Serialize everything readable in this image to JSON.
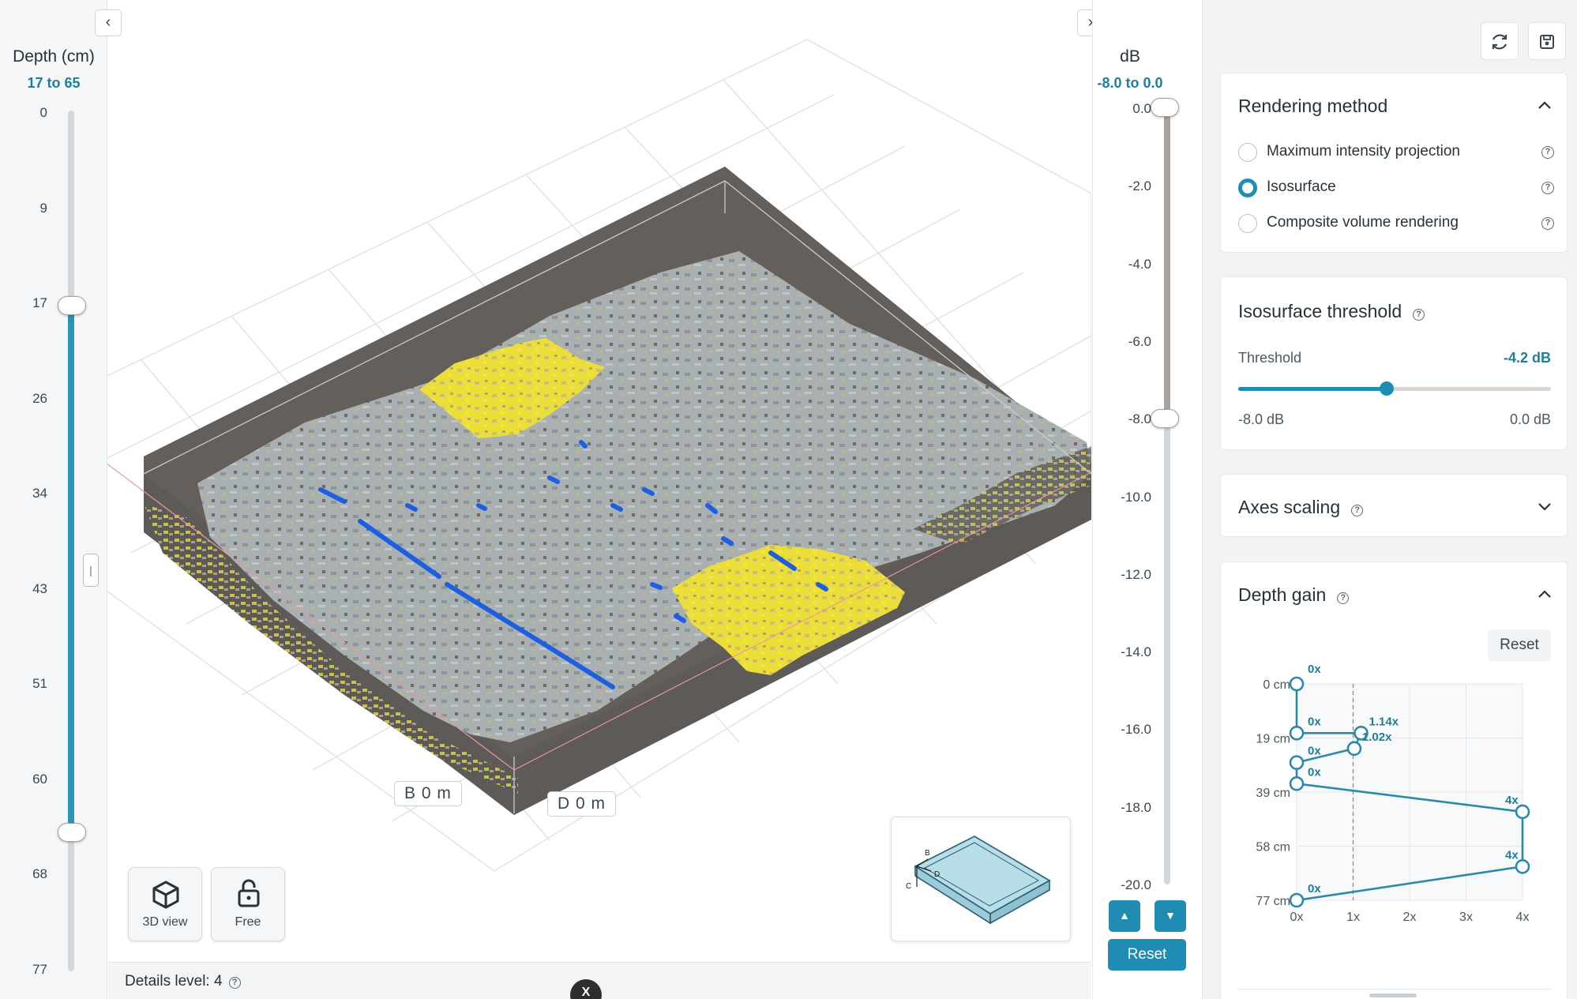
{
  "depth_axis": {
    "title": "Depth (cm)",
    "range": "17 to 65",
    "ticks": [
      "0",
      "9",
      "17",
      "26",
      "34",
      "43",
      "51",
      "60",
      "68",
      "77"
    ],
    "selected_min": 17,
    "selected_max": 65
  },
  "viewport": {
    "collapse_left_icon": "chevron-left-icon",
    "collapse_right_icon": "chevron-right-icon",
    "axis_labels": {
      "b": "B 0 m",
      "d": "D 0 m"
    },
    "tools": [
      {
        "icon": "cube-icon",
        "label": "3D view"
      },
      {
        "icon": "unlock-icon",
        "label": "Free"
      }
    ],
    "details_level": "Details level: 4",
    "orientation_labels": {
      "b": "B",
      "c": "C",
      "d": "D"
    },
    "close_chip": "X"
  },
  "db_axis": {
    "title": "dB",
    "range": "-8.0 to 0.0",
    "ticks": [
      "0.0",
      "-2.0",
      "-4.0",
      "-6.0",
      "-8.0",
      "-10.0",
      "-12.0",
      "-14.0",
      "-16.0",
      "-18.0",
      "-20.0"
    ],
    "selected_max": 0.0,
    "selected_min": -8.0,
    "reset_label": "Reset"
  },
  "panel": {
    "refresh_icon": "refresh-icon",
    "save_icon": "save-icon",
    "rendering": {
      "title": "Rendering method",
      "options": [
        {
          "label": "Maximum intensity projection",
          "selected": false
        },
        {
          "label": "Isosurface",
          "selected": true
        },
        {
          "label": "Composite volume rendering",
          "selected": false
        }
      ]
    },
    "threshold": {
      "title": "Isosurface threshold",
      "label": "Threshold",
      "value": "-4.2 dB",
      "min_label": "-8.0 dB",
      "max_label": "0.0 dB",
      "fraction": 0.475
    },
    "axes_scaling": {
      "title": "Axes scaling"
    },
    "depth_gain": {
      "title": "Depth gain",
      "reset_label": "Reset",
      "chart_data": {
        "type": "line",
        "y_ticks": [
          "0 cm",
          "19 cm",
          "39 cm",
          "58 cm",
          "77 cm"
        ],
        "x_ticks": [
          "0x",
          "1x",
          "2x",
          "3x",
          "4x"
        ],
        "points": [
          {
            "depth": 0,
            "gain": 0,
            "label": "0x"
          },
          {
            "depth": 17.5,
            "gain": 0,
            "label": "0x"
          },
          {
            "depth": 17.5,
            "gain": 1.14,
            "label": "1.14x"
          },
          {
            "depth": 23,
            "gain": 1.02,
            "label": "1.02x"
          },
          {
            "depth": 28,
            "gain": 0,
            "label": "0x"
          },
          {
            "depth": 35.5,
            "gain": 0,
            "label": "0x"
          },
          {
            "depth": 45.5,
            "gain": 4,
            "label": "4x"
          },
          {
            "depth": 65,
            "gain": 4,
            "label": "4x"
          },
          {
            "depth": 77,
            "gain": 0,
            "label": "0x"
          }
        ],
        "reference_gain": 1,
        "y_range": [
          0,
          77
        ],
        "x_range": [
          0,
          4
        ]
      }
    }
  }
}
